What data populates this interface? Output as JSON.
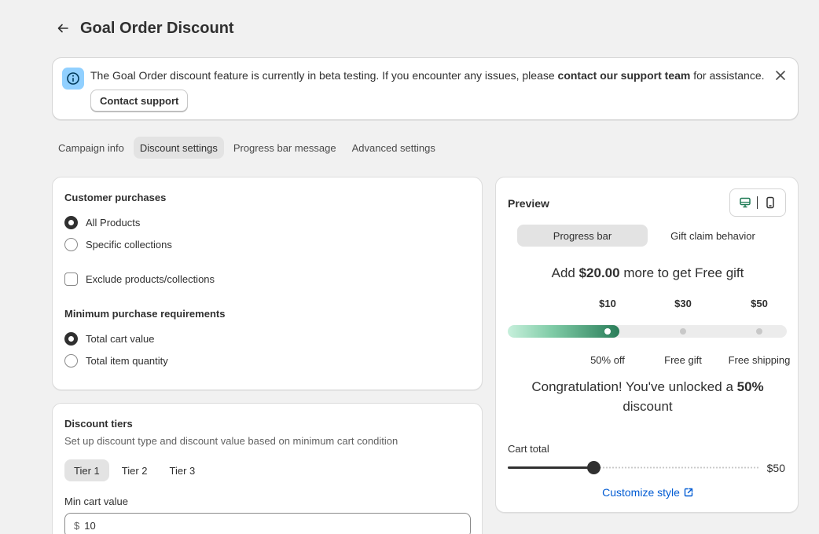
{
  "header": {
    "title": "Goal Order Discount"
  },
  "banner": {
    "text_before": "The Goal Order discount feature is currently in beta testing. If you encounter any issues, please ",
    "text_bold": "contact our support team",
    "text_after": " for assistance.",
    "button_label": "Contact support"
  },
  "tabs": [
    {
      "label": "Campaign info",
      "active": false
    },
    {
      "label": "Discount settings",
      "active": true
    },
    {
      "label": "Progress bar message",
      "active": false
    },
    {
      "label": "Advanced settings",
      "active": false
    }
  ],
  "purchases": {
    "title": "Customer purchases",
    "options": [
      {
        "label": "All Products",
        "selected": true
      },
      {
        "label": "Specific collections",
        "selected": false
      }
    ],
    "exclude_label": "Exclude products/collections",
    "min_title": "Minimum purchase requirements",
    "min_options": [
      {
        "label": "Total cart value",
        "selected": true
      },
      {
        "label": "Total item quantity",
        "selected": false
      }
    ]
  },
  "tiers": {
    "title": "Discount tiers",
    "description": "Set up discount type and discount value based on minimum cart condition",
    "tabs": [
      {
        "label": "Tier 1",
        "active": true
      },
      {
        "label": "Tier 2",
        "active": false
      },
      {
        "label": "Tier 3",
        "active": false
      }
    ],
    "min_cart_label": "Min cart value",
    "currency_prefix": "$",
    "min_cart_value": "10"
  },
  "preview": {
    "title": "Preview",
    "devices": [
      "desktop-icon",
      "mobile-icon"
    ],
    "segments": [
      {
        "label": "Progress bar",
        "active": true
      },
      {
        "label": "Gift claim behavior",
        "active": false
      }
    ],
    "goal_prefix": "Add ",
    "goal_amount": "$20.00",
    "goal_suffix": " more to get Free gift",
    "milestones": [
      {
        "amount": "$10",
        "reward": "50% off",
        "reached": true
      },
      {
        "amount": "$30",
        "reward": "Free gift",
        "reached": false
      },
      {
        "amount": "$50",
        "reward": "Free shipping",
        "reached": false
      }
    ],
    "progress_fraction": 0.4,
    "congrats_prefix": "Congratulation! You've unlocked a ",
    "congrats_bold": "50%",
    "congrats_suffix": " discount",
    "cart_total_label": "Cart total",
    "cart_total_fraction": 0.34,
    "cart_max": "$50",
    "customize_label": "Customize style",
    "accent_color": "#2a7d59",
    "link_color": "#005bd3"
  }
}
